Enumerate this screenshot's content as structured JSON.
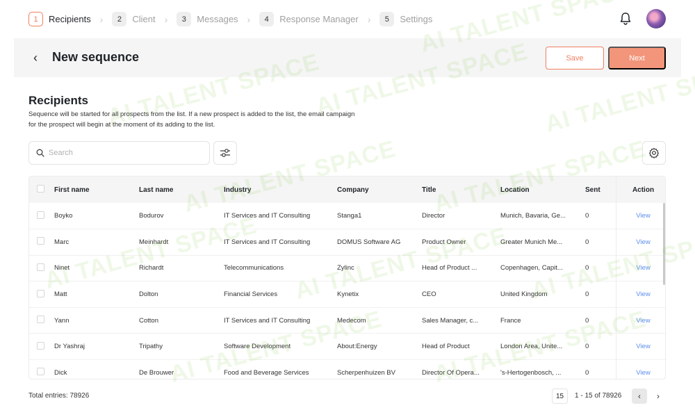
{
  "stepper": [
    {
      "num": "1",
      "label": "Recipients"
    },
    {
      "num": "2",
      "label": "Client"
    },
    {
      "num": "3",
      "label": "Messages"
    },
    {
      "num": "4",
      "label": "Response Manager"
    },
    {
      "num": "5",
      "label": "Settings"
    }
  ],
  "header": {
    "back_glyph": "‹",
    "title": "New sequence",
    "save_label": "Save",
    "next_label": "Next"
  },
  "recipients": {
    "title": "Recipients",
    "description": "Sequence will be started for all prospects from the list. If a new prospect is added to the list, the email campaign for the prospect will begin at the moment of its adding to the list."
  },
  "search": {
    "placeholder": "Search",
    "value": ""
  },
  "table": {
    "columns": [
      "First name",
      "Last name",
      "Industry",
      "Company",
      "Title",
      "Location",
      "Sent",
      "Action"
    ],
    "rows": [
      {
        "first": "Boyko",
        "last": "Bodurov",
        "industry": "IT Services and IT Consulting",
        "company": "Stanga1",
        "title": "Director",
        "location": "Munich, Bavaria, Ge...",
        "sent": "0",
        "action": "View"
      },
      {
        "first": "Marc",
        "last": "Meinhardt",
        "industry": "IT Services and IT Consulting",
        "company": "DOMUS Software AG",
        "title": "Product Owner",
        "location": "Greater Munich Me...",
        "sent": "0",
        "action": "View"
      },
      {
        "first": "Ninet",
        "last": "Richardt",
        "industry": "Telecommunications",
        "company": "Zylinc",
        "title": "Head of Product ...",
        "location": "Copenhagen, Capit...",
        "sent": "0",
        "action": "View"
      },
      {
        "first": "Matt",
        "last": "Dolton",
        "industry": "Financial Services",
        "company": "Kynetix",
        "title": "CEO",
        "location": "United Kingdom",
        "sent": "0",
        "action": "View"
      },
      {
        "first": "Yann",
        "last": "Cotton",
        "industry": "IT Services and IT Consulting",
        "company": "Medecom",
        "title": "Sales Manager, c...",
        "location": "France",
        "sent": "0",
        "action": "View"
      },
      {
        "first": "Dr Yashraj",
        "last": "Tripathy",
        "industry": "Software Development",
        "company": "About:Energy",
        "title": "Head of Product",
        "location": "London Area, Unite...",
        "sent": "0",
        "action": "View"
      },
      {
        "first": "Dick",
        "last": "De Brouwer",
        "industry": "Food and Beverage Services",
        "company": "Scherpenhuizen BV",
        "title": "Director Of Opera...",
        "location": "'s-Hertogenbosch, ...",
        "sent": "0",
        "action": "View"
      }
    ]
  },
  "footer": {
    "total": "Total entries: 78926",
    "page_size": "15",
    "range": "1 - 15 of 78926",
    "prev_glyph": "‹",
    "next_glyph": "›"
  },
  "watermark": "AI TALENT SPACE",
  "colors": {
    "accent": "#f07e60",
    "accent_light": "#f3957a",
    "link": "#5b8def"
  }
}
